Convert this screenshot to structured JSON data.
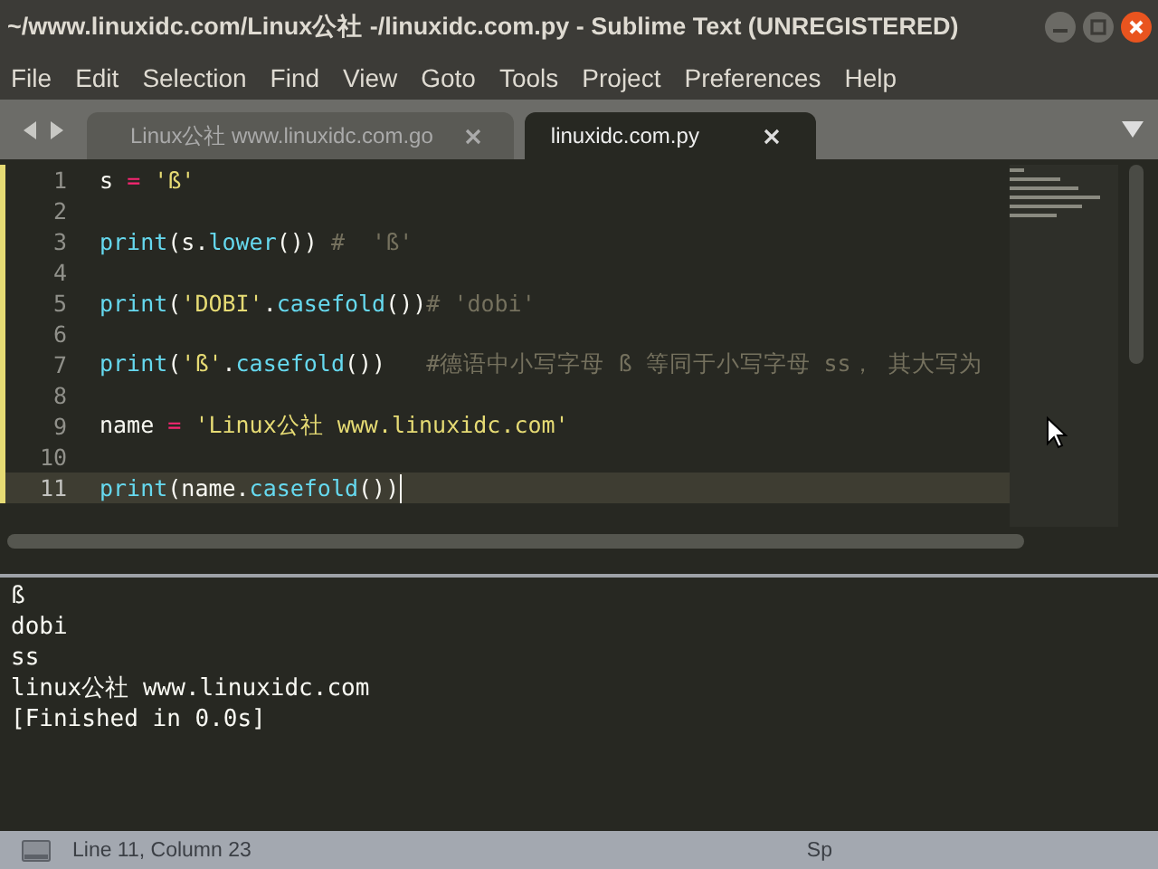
{
  "window": {
    "title": "~/www.linuxidc.com/Linux公社 -/linuxidc.com.py - Sublime Text (UNREGISTERED)"
  },
  "menu": [
    "File",
    "Edit",
    "Selection",
    "Find",
    "View",
    "Goto",
    "Tools",
    "Project",
    "Preferences",
    "Help"
  ],
  "tabs": [
    {
      "label": "Linux公社 www.linuxidc.com.go",
      "selected": false
    },
    {
      "label": "linuxidc.com.py",
      "selected": true
    }
  ],
  "editor": {
    "lines": [
      {
        "number": "1",
        "modified": true,
        "current": false,
        "tokens": [
          {
            "kind": "plain",
            "text": "s "
          },
          {
            "kind": "op",
            "text": "= "
          },
          {
            "kind": "str",
            "text": "'ß'"
          }
        ]
      },
      {
        "number": "2",
        "modified": true,
        "current": false
      },
      {
        "number": "3",
        "modified": true,
        "current": false,
        "tokens": [
          {
            "kind": "func",
            "text": "print"
          },
          {
            "kind": "plain",
            "text": "(s."
          },
          {
            "kind": "func",
            "text": "lower"
          },
          {
            "kind": "plain",
            "text": "()) "
          },
          {
            "kind": "comment",
            "text": "#  'ß'"
          }
        ]
      },
      {
        "number": "4",
        "modified": true,
        "current": false
      },
      {
        "number": "5",
        "modified": true,
        "current": false,
        "tokens": [
          {
            "kind": "func",
            "text": "print"
          },
          {
            "kind": "plain",
            "text": "("
          },
          {
            "kind": "str",
            "text": "'DOBI'"
          },
          {
            "kind": "plain",
            "text": "."
          },
          {
            "kind": "func",
            "text": "casefold"
          },
          {
            "kind": "plain",
            "text": "())"
          },
          {
            "kind": "comment",
            "text": "# 'dobi'"
          }
        ]
      },
      {
        "number": "6",
        "modified": true,
        "current": false
      },
      {
        "number": "7",
        "modified": true,
        "current": false,
        "tokens": [
          {
            "kind": "func",
            "text": "print"
          },
          {
            "kind": "plain",
            "text": "("
          },
          {
            "kind": "str",
            "text": "'ß'"
          },
          {
            "kind": "plain",
            "text": "."
          },
          {
            "kind": "func",
            "text": "casefold"
          },
          {
            "kind": "plain",
            "text": "())   "
          },
          {
            "kind": "comment",
            "text": "#德语中小写字母 ß 等同于小写字母 ss， 其大写为"
          }
        ]
      },
      {
        "number": "8",
        "modified": true,
        "current": false
      },
      {
        "number": "9",
        "modified": true,
        "current": false,
        "tokens": [
          {
            "kind": "plain",
            "text": "name "
          },
          {
            "kind": "op",
            "text": "= "
          },
          {
            "kind": "str",
            "text": "'Linux公社 www.linuxidc.com'"
          }
        ]
      },
      {
        "number": "10",
        "modified": true,
        "current": false
      },
      {
        "number": "11",
        "modified": true,
        "current": true,
        "tokens": [
          {
            "kind": "func",
            "text": "print"
          },
          {
            "kind": "plain",
            "text": "(name."
          },
          {
            "kind": "func",
            "text": "casefold"
          },
          {
            "kind": "plain",
            "text": "())"
          }
        ]
      }
    ]
  },
  "output": [
    "ß",
    "dobi",
    "ss",
    "linux公社 www.linuxidc.com",
    "[Finished in 0.0s]"
  ],
  "status_bar": {
    "position": "Line 11, Column 23",
    "indent": "Sp"
  }
}
